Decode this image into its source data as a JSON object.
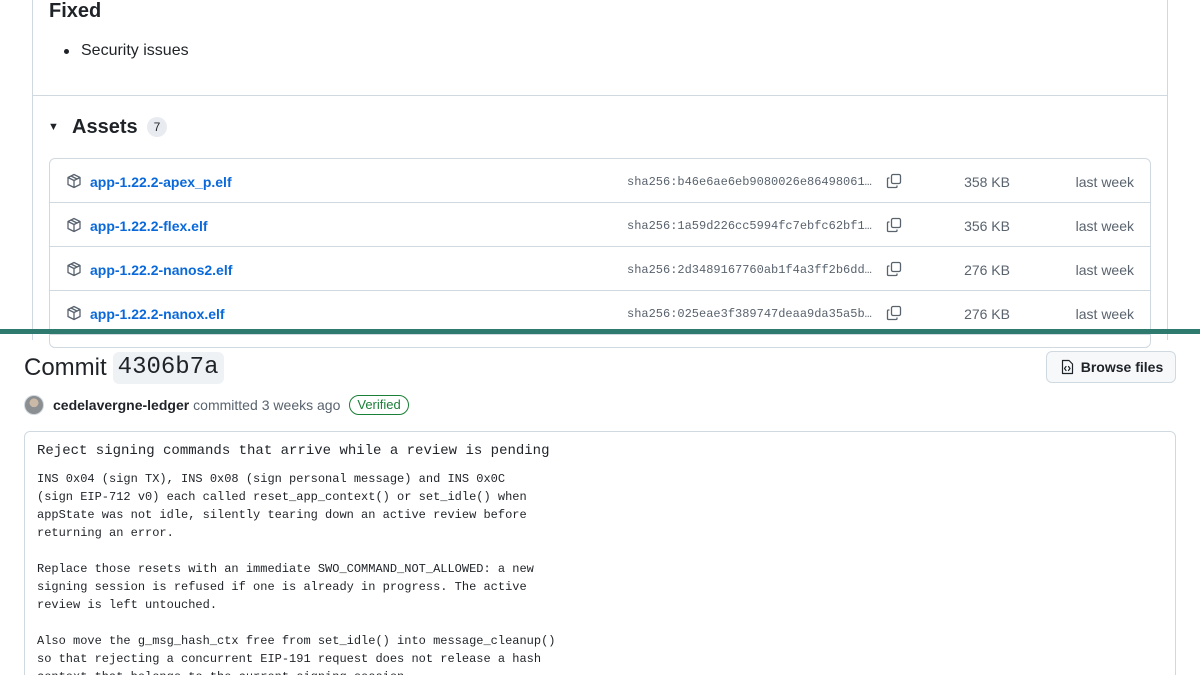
{
  "release": {
    "fixed_heading": "Fixed",
    "fixed_items": [
      "Security issues"
    ],
    "assets": {
      "title": "Assets",
      "count": "7",
      "rows": [
        {
          "name": "app-1.22.2-apex_p.elf",
          "sha": "sha256:b46e6ae6eb9080026e86498061…",
          "size": "358 KB",
          "time": "last week"
        },
        {
          "name": "app-1.22.2-flex.elf",
          "sha": "sha256:1a59d226cc5994fc7ebfc62bf1…",
          "size": "356 KB",
          "time": "last week"
        },
        {
          "name": "app-1.22.2-nanos2.elf",
          "sha": "sha256:2d3489167760ab1f4a3ff2b6dd…",
          "size": "276 KB",
          "time": "last week"
        },
        {
          "name": "app-1.22.2-nanox.elf",
          "sha": "sha256:025eae3f389747deaa9da35a5b…",
          "size": "276 KB",
          "time": "last week"
        }
      ]
    }
  },
  "commit": {
    "title_prefix": "Commit",
    "sha": "4306b7a",
    "browse_label": "Browse files",
    "author": "cedelavergne-ledger",
    "action": "committed",
    "time": "3 weeks ago",
    "verified": "Verified",
    "message_summary": "Reject signing commands that arrive while a review is pending",
    "message_body": "INS 0x04 (sign TX), INS 0x08 (sign personal message) and INS 0x0C\n(sign EIP-712 v0) each called reset_app_context() or set_idle() when\nappState was not idle, silently tearing down an active review before\nreturning an error.\n\nReplace those resets with an immediate SWO_COMMAND_NOT_ALLOWED: a new\nsigning session is refused if one is already in progress. The active\nreview is left untouched.\n\nAlso move the g_msg_hash_ctx free from set_idle() into message_cleanup()\nso that rejecting a concurrent EIP-191 request does not release a hash\ncontext that belongs to the current signing session."
  },
  "colors": {
    "link": "#0969da",
    "verified": "#1a7f37",
    "divider_bar": "#2e7a6f"
  },
  "icons": {
    "asset": "package-icon",
    "copy": "copy-icon",
    "browse": "file-code-icon",
    "caret": "triangle-down-icon"
  }
}
